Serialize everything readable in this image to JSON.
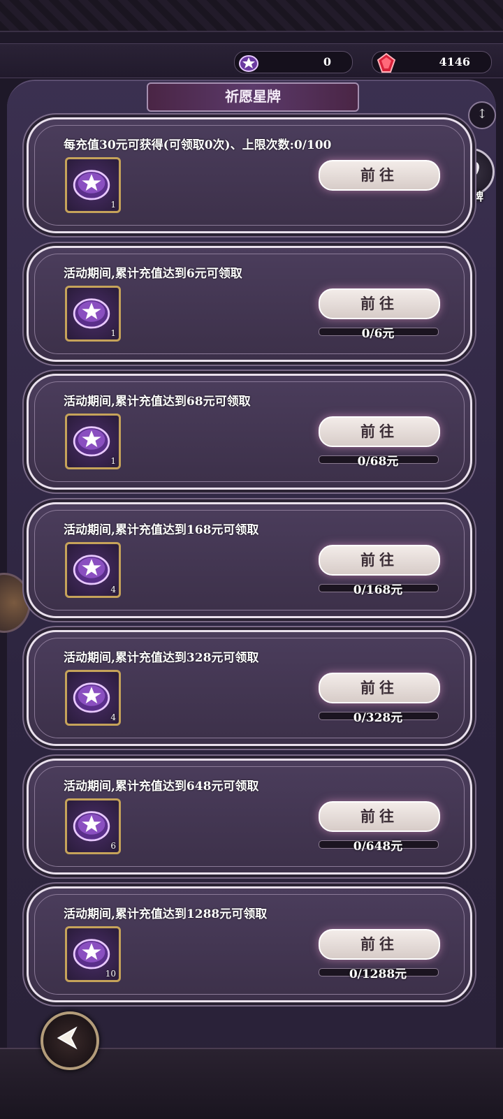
{
  "resources": {
    "star_token": {
      "value": "0",
      "icon": "star-token-icon"
    },
    "gem": {
      "value": "4146",
      "icon": "red-gem-icon"
    }
  },
  "page": {
    "title": "祈愿星牌",
    "side_badge_label": "祈愿星牌"
  },
  "cards": [
    {
      "title": "每充值30元可获得(可领取0次)、上限次数:0/100",
      "item_count": "1",
      "button": "前往",
      "progress_text": null,
      "progress": null
    },
    {
      "title": "活动期间,累计充值达到6元可领取",
      "item_count": "1",
      "button": "前往",
      "progress_text": "0/6元",
      "progress": 0
    },
    {
      "title": "活动期间,累计充值达到68元可领取",
      "item_count": "1",
      "button": "前往",
      "progress_text": "0/68元",
      "progress": 0
    },
    {
      "title": "活动期间,累计充值达到168元可领取",
      "item_count": "4",
      "button": "前往",
      "progress_text": "0/168元",
      "progress": 0
    },
    {
      "title": "活动期间,累计充值达到328元可领取",
      "item_count": "4",
      "button": "前往",
      "progress_text": "0/328元",
      "progress": 0
    },
    {
      "title": "活动期间,累计充值达到648元可领取",
      "item_count": "6",
      "button": "前往",
      "progress_text": "0/648元",
      "progress": 0
    },
    {
      "title": "活动期间,累计充值达到1288元可领取",
      "item_count": "10",
      "button": "前往",
      "progress_text": "0/1288元",
      "progress": 0
    }
  ],
  "colors": {
    "background": "#1e1828",
    "panel": "#3b3050",
    "button": "#efe6e4",
    "accent_gold": "#c6a35a"
  }
}
